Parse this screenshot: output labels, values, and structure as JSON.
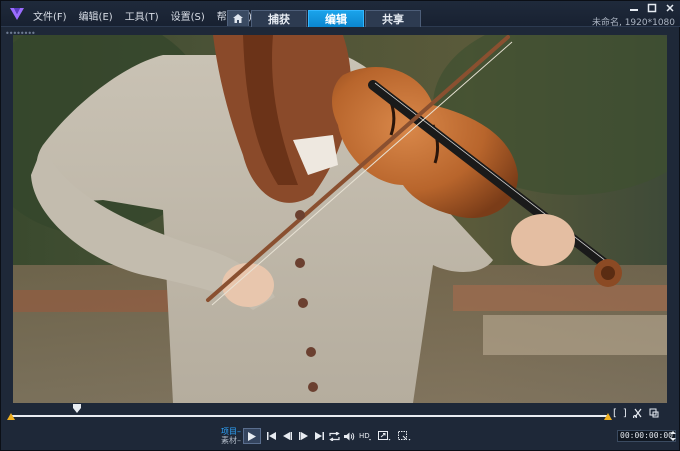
{
  "titlebar": {
    "menu": [
      {
        "label": "文件(F)"
      },
      {
        "label": "编辑(E)"
      },
      {
        "label": "工具(T)"
      },
      {
        "label": "设置(S)"
      },
      {
        "label": "帮助(H)"
      }
    ],
    "tabs": [
      {
        "label": "捕获",
        "active": false
      },
      {
        "label": "编辑",
        "active": true
      },
      {
        "label": "共享",
        "active": false
      }
    ],
    "project_info": "未命名, 1920*1080",
    "home_icon": "home-icon"
  },
  "preview": {
    "icon": "video-frame"
  },
  "timeline": {
    "trim_start": "[",
    "trim_end": "]",
    "playhead_position": 0.11
  },
  "controls": {
    "mode_project": "项目–",
    "mode_clip": "素材–",
    "timecode": "00:00:00:00",
    "icons": [
      "play-icon",
      "start-icon",
      "prev-frame-icon",
      "next-frame-icon",
      "end-icon",
      "repeat-icon",
      "volume-icon",
      "hd-icon",
      "enlarge-icon",
      "crop-icon"
    ]
  },
  "colors": {
    "accent": "#0b86cf",
    "trim_marker": "#f0b020",
    "background": "#1e2838"
  }
}
